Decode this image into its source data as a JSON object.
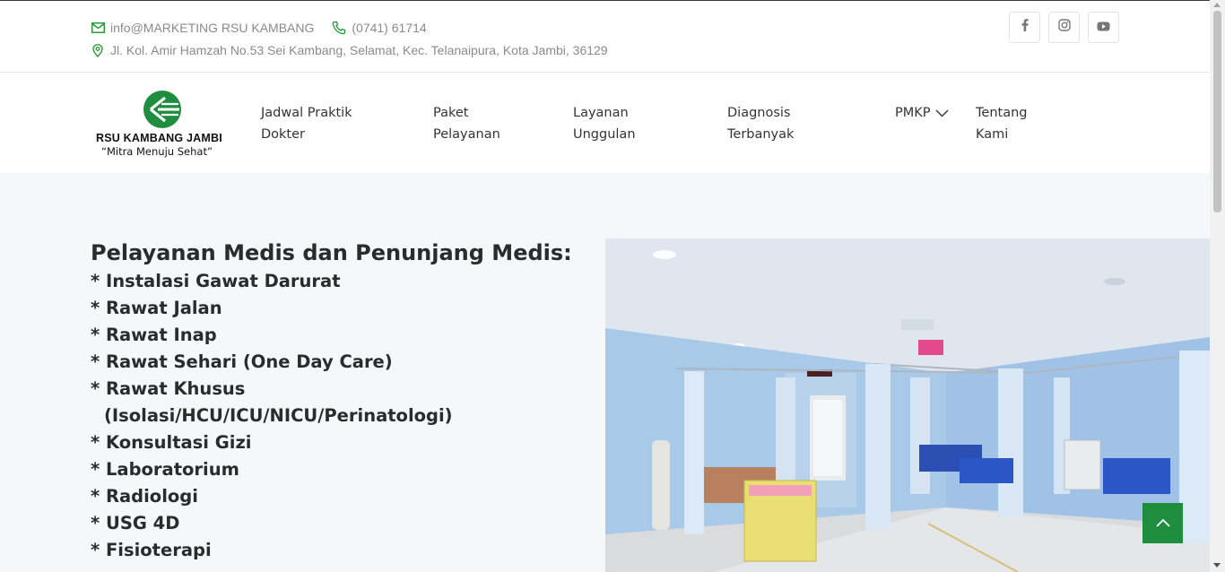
{
  "topbar": {
    "email": "info@MARKETING RSU KAMBANG",
    "phone": "(0741) 61714",
    "address": "Jl. Kol. Amir Hamzah No.53 Sei Kambang, Selamat, Kec. Telanaipura, Kota Jambi, 36129",
    "socials": [
      {
        "name": "facebook-icon"
      },
      {
        "name": "instagram-icon"
      },
      {
        "name": "youtube-icon"
      }
    ]
  },
  "logo": {
    "name": "RSU KAMBANG JAMBI",
    "tagline": "“Mitra Menuju Sehat”"
  },
  "nav": {
    "items": [
      {
        "line1": "Jadwal Praktik",
        "line2": "Dokter"
      },
      {
        "line1": "Paket",
        "line2": "Pelayanan"
      },
      {
        "line1": "Layanan",
        "line2": "Unggulan"
      },
      {
        "line1": "Diagnosis",
        "line2": "Terbanyak"
      },
      {
        "line1": "PMKP",
        "line2": ""
      },
      {
        "line1": "Tentang",
        "line2": "Kami"
      }
    ]
  },
  "main": {
    "heading": "Pelayanan Medis dan Penunjang Medis:",
    "services": [
      "* Instalasi Gawat Darurat",
      "* Rawat Jalan",
      "* Rawat Inap",
      "* Rawat Sehari (One Day Care)",
      "* Rawat Khusus",
      "(Isolasi/HCU/ICU/NICU/Perinatologi)",
      "* Konsultasi Gizi",
      "* Laboratorium",
      "* Radiologi",
      "* USG 4D",
      "* Fisioterapi"
    ]
  },
  "colors": {
    "brand_green": "#1e8e3e",
    "icon_green": "#2e9a3c",
    "text_dark": "#2b2b2b",
    "muted": "#8a8a8a",
    "main_bg": "#f5f7fb"
  }
}
